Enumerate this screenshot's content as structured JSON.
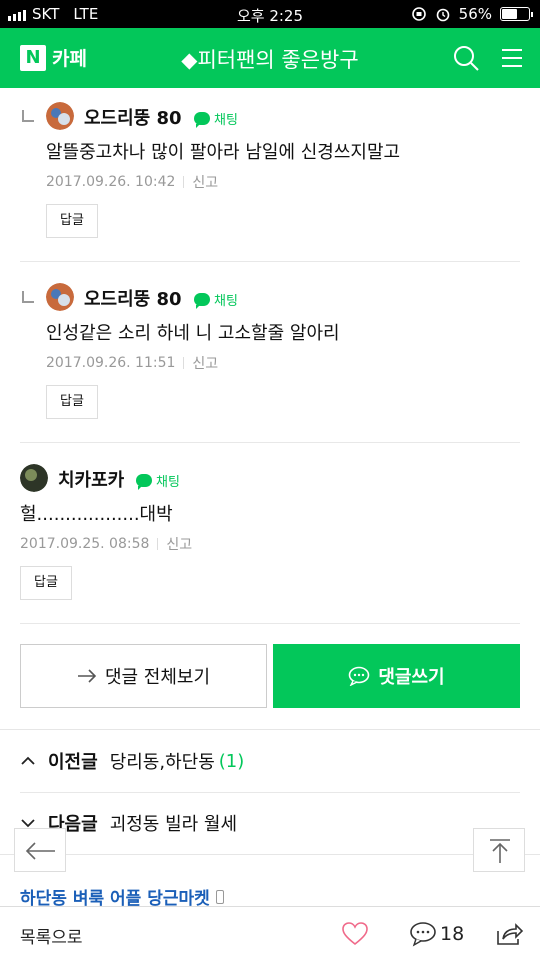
{
  "status_bar": {
    "carrier": "SKT",
    "network": "LTE",
    "time": "오후 2:25",
    "battery": "56%",
    "battery_level": 0.56
  },
  "header": {
    "logo_letter": "N",
    "logo_text": "카페",
    "cafe_title": "◆피터팬의 좋은방구"
  },
  "comments": [
    {
      "nickname": "오드리뚱 80",
      "chat_label": "채팅",
      "text": "알뜰중고차나 많이 팔아라 남일에 신경쓰지말고",
      "date": "2017.09.26. 10:42",
      "report_label": "신고",
      "reply_label": "답글"
    },
    {
      "nickname": "오드리뚱 80",
      "chat_label": "채팅",
      "text": "인성같은 소리 하네 니 고소할줄 알아리",
      "date": "2017.09.26. 11:51",
      "report_label": "신고",
      "reply_label": "답글"
    },
    {
      "nickname": "치카포카",
      "chat_label": "채팅",
      "text": "헐..................대박",
      "date": "2017.09.25. 08:58",
      "report_label": "신고",
      "reply_label": "답글"
    }
  ],
  "actions": {
    "view_all_label": "댓글 전체보기",
    "write_label": "댓글쓰기"
  },
  "nav": {
    "prev_label": "이전글",
    "prev_title": "당리동,하단동",
    "prev_count": "(1)",
    "next_label": "다음글",
    "next_title": "괴정동 빌라 월세"
  },
  "promo": {
    "text": "하단동 벼룩 어플 당근마켓"
  },
  "bottom_bar": {
    "list_label": "목록으로",
    "comment_count": "18"
  },
  "colors": {
    "brand_green": "#03c75a",
    "link_blue": "#1b5fb8",
    "meta_gray": "#999999"
  }
}
